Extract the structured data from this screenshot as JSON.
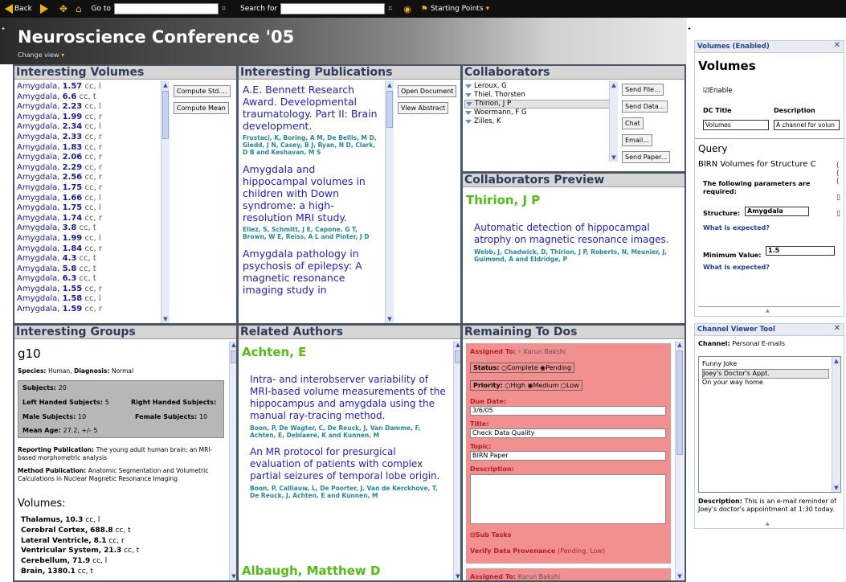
{
  "toolbar": {
    "back_label": "Back",
    "goto_label": "Go to",
    "search_label": "Search for",
    "starting_points_label": "Starting Points"
  },
  "header": {
    "title": "Neuroscience Conference '05",
    "change_view": "Change view"
  },
  "volumes_panel": {
    "title": "Interesting Volumes",
    "items": [
      {
        "name": "Amygdala",
        "value": "1.57",
        "suffix": "cc, l"
      },
      {
        "name": "Amygdala",
        "value": "6.6",
        "suffix": "cc, t"
      },
      {
        "name": "Amygdala",
        "value": "2.23",
        "suffix": "cc, l"
      },
      {
        "name": "Amygdala",
        "value": "1.99",
        "suffix": "cc, r"
      },
      {
        "name": "Amygdala",
        "value": "2.34",
        "suffix": "cc, l"
      },
      {
        "name": "Amygdala",
        "value": "2.33",
        "suffix": "cc, r"
      },
      {
        "name": "Amygdala",
        "value": "1.83",
        "suffix": "cc, r"
      },
      {
        "name": "Amygdala",
        "value": "2.06",
        "suffix": "cc, r"
      },
      {
        "name": "Amygdala",
        "value": "2.29",
        "suffix": "cc, r"
      },
      {
        "name": "Amygdala",
        "value": "2.56",
        "suffix": "cc, r"
      },
      {
        "name": "Amygdala",
        "value": "1.75",
        "suffix": "cc, r"
      },
      {
        "name": "Amygdala",
        "value": "1.66",
        "suffix": "cc, l"
      },
      {
        "name": "Amygdala",
        "value": "1.75",
        "suffix": "cc, l"
      },
      {
        "name": "Amygdala",
        "value": "1.74",
        "suffix": "cc, r"
      },
      {
        "name": "Amygdala",
        "value": "3.8",
        "suffix": "cc, t"
      },
      {
        "name": "Amygdala",
        "value": "1.99",
        "suffix": "cc, l"
      },
      {
        "name": "Amygdala",
        "value": "1.84",
        "suffix": "cc, r"
      },
      {
        "name": "Amygdala",
        "value": "4.3",
        "suffix": "cc, t"
      },
      {
        "name": "Amygdala",
        "value": "5.8",
        "suffix": "cc, t"
      },
      {
        "name": "Amygdala",
        "value": "6.3",
        "suffix": "cc, t"
      },
      {
        "name": "Amygdala",
        "value": "1.55",
        "suffix": "cc, r"
      },
      {
        "name": "Amygdala",
        "value": "1.58",
        "suffix": "cc, l"
      },
      {
        "name": "Amygdala",
        "value": "1.59",
        "suffix": "cc, r"
      }
    ],
    "compute_std": "Compute Std....",
    "compute_mean": "Compute Mean"
  },
  "publications_panel": {
    "title": "Interesting Publications",
    "open_document": "Open Document",
    "view_abstract": "View Abstract",
    "items": [
      {
        "title": "A.E. Bennett Research Award. Developmental traumatology. Part II: Brain development.",
        "authors": "Frustaci, K, Boring, A M, De Bellis, M D, Giedd, J N, Casey, B J, Ryan, N D, Clark, D B and Keshavan, M S"
      },
      {
        "title": "Amygdala and hippocampal volumes in children with Down syndrome: a high-resolution MRI study.",
        "authors": "Eliez, S, Schmitt, J E, Capone, G T, Brown, W E, Reiss, A L and Pinter, J D"
      },
      {
        "title": "Amygdala pathology in psychosis of epilepsy: A magnetic resonance imaging study in",
        "authors": ""
      }
    ]
  },
  "collaborators_panel": {
    "title": "Collaborators",
    "items": [
      "Leroux, G",
      "Thiel, Thorsten",
      "Thirion, J P",
      "Woermann, F G",
      "Zilles, K"
    ],
    "buttons": [
      "Send File...",
      "Send Data...",
      "Chat",
      "Email...",
      "Send Paper..."
    ]
  },
  "collab_preview": {
    "title": "Collaborators Preview",
    "name": "Thirion, J P",
    "pub_title": "Automatic detection of hippocampal atrophy on magnetic resonance images.",
    "pub_authors": "Webb, J, Chadwick, D, Thirion, J P, Roberts, N, Meunier, J, Guimond, A and Eldridge, P"
  },
  "groups_panel": {
    "title": "Interesting Groups",
    "group_name": "g10",
    "species_line": {
      "species_label": "Species:",
      "species": "Human,",
      "diagnosis_label": "Diagnosis:",
      "diagnosis": "Normal"
    },
    "subjects_label": "Subjects:",
    "subjects": "20",
    "left_label": "Left Handed Subjects:",
    "left": "5",
    "right_label": "Right Handed Subjects:",
    "male_label": "Male Subjects:",
    "male": "10",
    "female_label": "Female Subjects:",
    "female": "10",
    "age_label": "Mean Age:",
    "age": "27.2, +/- 5",
    "reporting_label": "Reporting Publication:",
    "reporting": "The young adult human brain: an MRI-based morphometric analysis",
    "method_label": "Method Publication:",
    "method": "Anatomic Segmentation and Volumetric Calculations in Nuclear Magnetic Resonance Imaging",
    "volumes_label": "Volumes:",
    "volumes": [
      {
        "name": "Thalamus,",
        "value": "10.3",
        "suffix": "cc, l"
      },
      {
        "name": "Cerebral Cortex,",
        "value": "688.8",
        "suffix": "cc, t"
      },
      {
        "name": "Lateral Ventricle,",
        "value": "8.1",
        "suffix": "cc, r"
      },
      {
        "name": "Ventricular System,",
        "value": "21.3",
        "suffix": "cc, t"
      },
      {
        "name": "Cerebellum,",
        "value": "71.9",
        "suffix": "cc, l"
      },
      {
        "name": "Brain,",
        "value": "1380.1",
        "suffix": "cc, t"
      }
    ]
  },
  "authors_panel": {
    "title": "Related Authors",
    "author1": "Achten, E",
    "pubs": [
      {
        "title": "Intra- and interobserver variability of MRI-based volume measurements of the hippocampus and amygdala using the manual ray-tracing method.",
        "authors": "Boon, P, De Wagter, C, De Reuck, J, Van Damme, F, Achten, E, Deblaere, K and Kunnen, M"
      },
      {
        "title": "An MR protocol for presurgical evaluation of patients with complex partial seizures of temporal lobe origin.",
        "authors": "Boon, P, Calliauw, L, De Poorter, J, Van de Kerckhove, T, De Reuck, J, Achten, E and Kunnen, M"
      }
    ],
    "author2": "Albaugh, Matthew D"
  },
  "todos_panel": {
    "title": "Remaining To Dos",
    "assigned_label": "Assigned To:",
    "assigned": "Karun Bakshi",
    "status_label": "Status:",
    "status_complete": "Complete",
    "status_pending": "Pending",
    "priority_label": "Priority:",
    "priority_high": "High",
    "priority_medium": "Medium",
    "priority_low": "Low",
    "due_label": "Due Date:",
    "due": "3/6/05",
    "title_label": "Title:",
    "title_value": "Check Data Quality",
    "topic_label": "Topic:",
    "topic": "BIRN Paper",
    "description_label": "Description:",
    "subtasks_label": "Sub Tasks",
    "subtask": "Verify Data Provenance",
    "subtask_meta": "(Pending, Low)",
    "assigned2_label": "Assigned To:",
    "assigned2": "Karun Bakshi"
  },
  "volumes_side": {
    "header": "Volumes (Enabled)",
    "title": "Volumes",
    "enable_label": "Enable",
    "dc_title_label": "DC Title",
    "description_label": "Description",
    "dc_title_value": "Volumes",
    "description_value": "A channel for volun",
    "query_label": "Query",
    "query_title": "BIRN Volumes for Structure C",
    "params_label": "The following parameters are required:",
    "structure_label": "Structure:",
    "structure_value": "Amygdala",
    "what_expected1": "What is expected?",
    "min_label": "Minimum Value:",
    "min_value": "1.5",
    "what_expected2": "What is expected?"
  },
  "channel_side": {
    "header": "Channel Viewer Tool",
    "channel_label": "Channel:",
    "channel": "Personal E-mails",
    "items": [
      "Funny Joke",
      "Joey's Doctor's Appt.",
      "On your way home"
    ],
    "desc_label": "Description:",
    "desc": "This is an e-mail reminder of Joey's doctor's appointment at 1:30 today."
  },
  "colors": {
    "panel_border": "#4a5668",
    "panel_header_bg": "#d6d6d6",
    "panel_header_text": "#2e3c5a",
    "link_blue": "#2020d0",
    "author_teal": "#1f8a9a",
    "name_green": "#4fbf10",
    "todo_pink": "#f28f8f",
    "toolbar_bg": "#101010",
    "accent_gold": "#f2b300"
  }
}
